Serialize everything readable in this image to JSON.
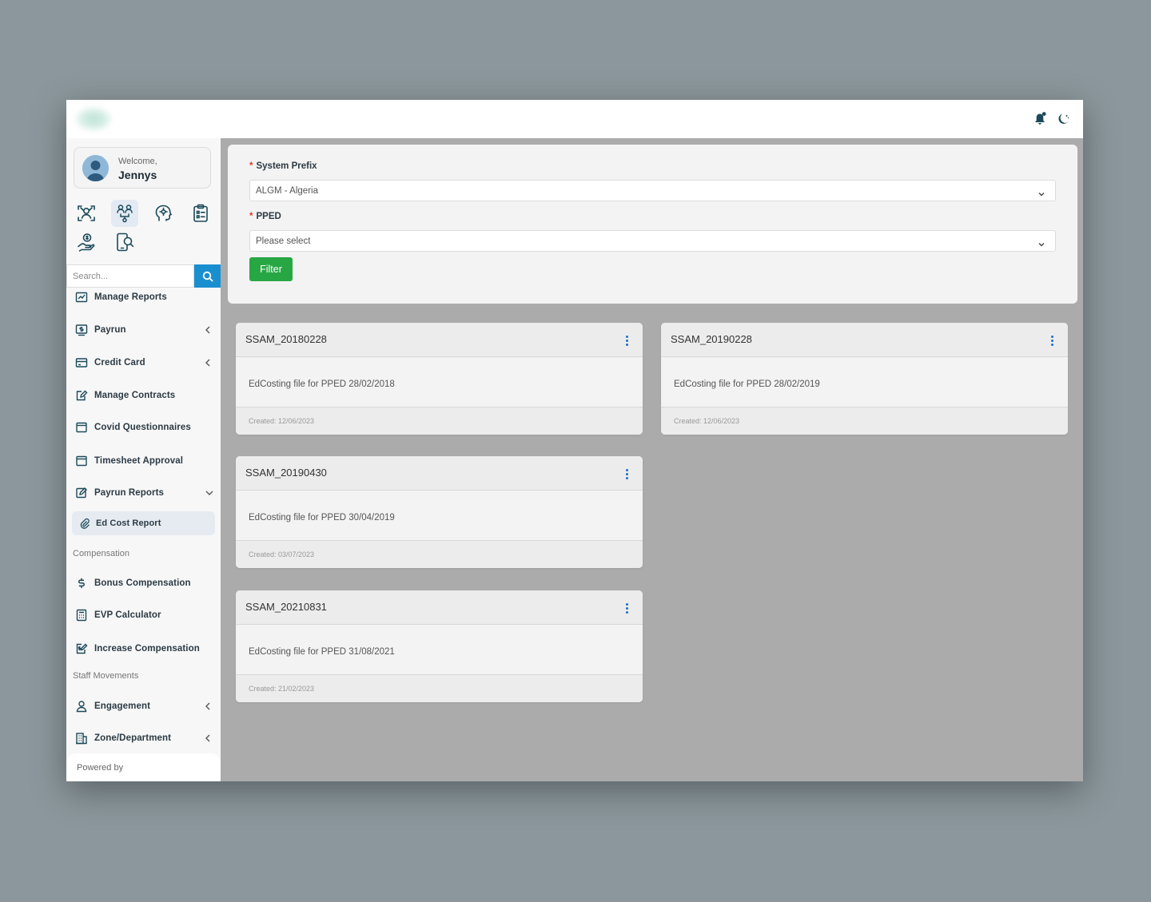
{
  "user": {
    "welcome_label": "Welcome,",
    "name": "Jennys"
  },
  "topbar": {
    "icons": [
      "bell-icon",
      "moon-icon"
    ]
  },
  "module_icons": [
    "face-scan-icon",
    "org-chart-icon",
    "head-gear-icon",
    "clipboard-icon",
    "hand-coin-icon",
    "device-search-icon"
  ],
  "search": {
    "placeholder": "Search..."
  },
  "nav": {
    "manage_reports": "Manage Reports",
    "payrun": "Payrun",
    "credit_card": "Credit Card",
    "manage_contracts": "Manage Contracts",
    "covid_questionnaires": "Covid Questionnaires",
    "timesheet_approval": "Timesheet Approval",
    "payrun_reports": "Payrun Reports",
    "ed_cost_report": "Ed Cost Report",
    "section_compensation": "Compensation",
    "bonus_compensation": "Bonus Compensation",
    "evp_calculator": "EVP Calculator",
    "increase_compensation": "Increase Compensation",
    "section_staff_movements": "Staff Movements",
    "engagement": "Engagement",
    "zone_department": "Zone/Department",
    "powered_by": "Powered by"
  },
  "filter": {
    "required_mark": "*",
    "system_prefix_label": "System Prefix",
    "system_prefix_value": "ALGM - Algeria",
    "pped_label": "PPED",
    "pped_placeholder": "Please select",
    "filter_button": "Filter"
  },
  "cards": [
    {
      "title": "SSAM_20180228",
      "description": "EdCosting file for PPED 28/02/2018",
      "created": "Created: 12/06/2023"
    },
    {
      "title": "SSAM_20190228",
      "description": "EdCosting file for PPED 28/02/2019",
      "created": "Created: 12/06/2023"
    },
    {
      "title": "SSAM_20190430",
      "description": "EdCosting file for PPED 30/04/2019",
      "created": "Created: 03/07/2023"
    },
    {
      "title": "SSAM_20210831",
      "description": "EdCosting file for PPED 31/08/2021",
      "created": "Created: 21/02/2023"
    }
  ],
  "colors": {
    "accent_blue": "#1a8fd0",
    "filter_green": "#27a744",
    "required_red": "#e0392b",
    "icon_dark": "#1c4a5a",
    "kebab_blue": "#1a6fd0"
  }
}
